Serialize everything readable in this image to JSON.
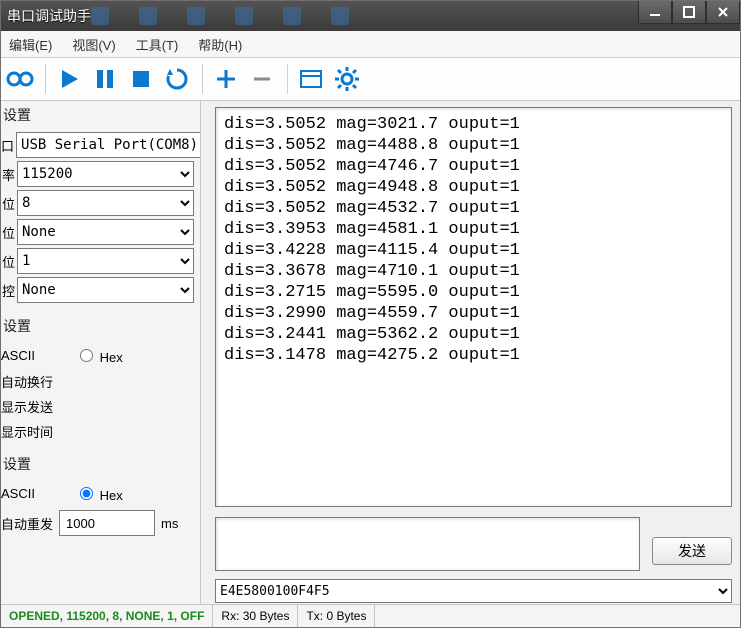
{
  "window": {
    "title": "串口调试助手"
  },
  "menus": {
    "edit": "编辑(E)",
    "view": "视图(V)",
    "tool": "工具(T)",
    "help": "帮助(H)"
  },
  "settings": {
    "group_port": "设置",
    "port": "USB Serial Port(COM8)",
    "baud": "115200",
    "databits": "8",
    "parity": "None",
    "stopbits": "1",
    "flow": "None"
  },
  "recv": {
    "group": "设置",
    "ascii": "ASCII",
    "hex": "Hex",
    "autowrap": "自动换行",
    "showsend": "显示发送",
    "showtime": "显示时间"
  },
  "send": {
    "group": "设置",
    "ascii": "ASCII",
    "hex": "Hex",
    "autorepeat": "自动重发",
    "interval": "1000",
    "unit": "ms",
    "button": "发送",
    "hexline": "E4E5800100F4F5"
  },
  "output_lines": [
    "dis=3.5052 mag=3021.7 ouput=1",
    "dis=3.5052 mag=4488.8 ouput=1",
    "dis=3.5052 mag=4746.7 ouput=1",
    "dis=3.5052 mag=4948.8 ouput=1",
    "dis=3.5052 mag=4532.7 ouput=1",
    "dis=3.3953 mag=4581.1 ouput=1",
    "dis=3.4228 mag=4115.4 ouput=1",
    "dis=3.3678 mag=4710.1 ouput=1",
    "dis=3.2715 mag=5595.0 ouput=1",
    "dis=3.2990 mag=4559.7 ouput=1",
    "dis=3.2441 mag=5362.2 ouput=1",
    "dis=3.1478 mag=4275.2 ouput=1"
  ],
  "status": {
    "conn": "OPENED, 115200, 8, NONE, 1, OFF",
    "rx": "Rx: 30 Bytes",
    "tx": "Tx: 0 Bytes"
  }
}
